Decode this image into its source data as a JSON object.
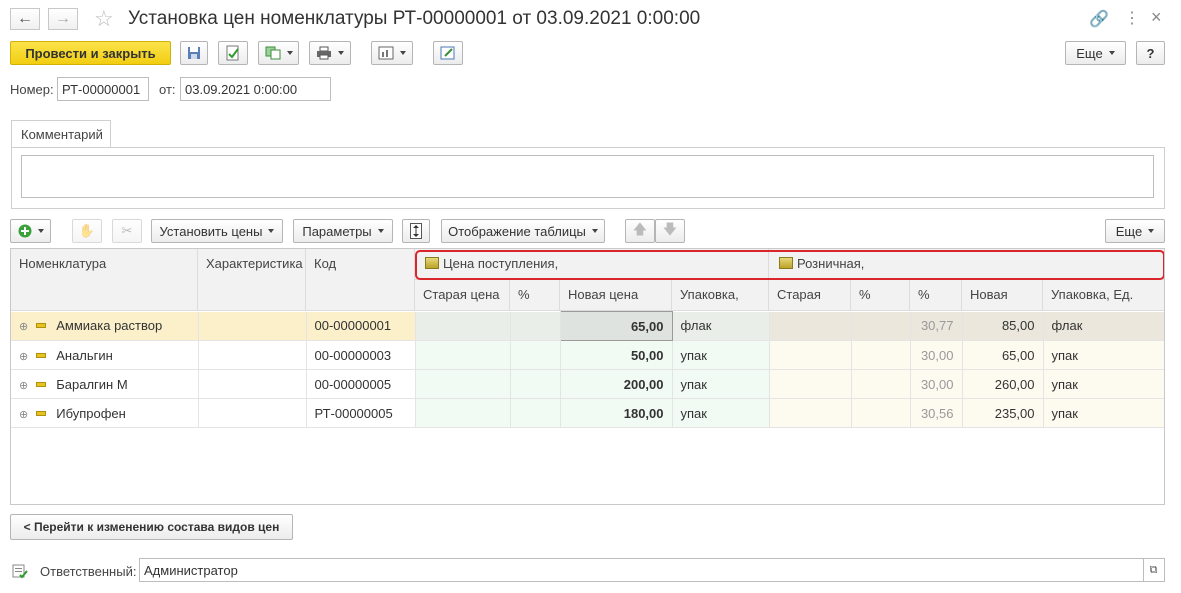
{
  "window": {
    "title": "Установка цен номенклатуры РТ-00000001 от 03.09.2021 0:00:00"
  },
  "toolbar": {
    "post_close_label": "Провести и закрыть",
    "more_label": "Еще",
    "help_label": "?"
  },
  "header": {
    "number_label": "Номер:",
    "number_value": "РТ-00000001",
    "date_label": "от:",
    "date_value": "03.09.2021  0:00:00"
  },
  "comment": {
    "tab_label": "Комментарий",
    "value": ""
  },
  "table_toolbar": {
    "set_prices_label": "Установить цены",
    "params_label": "Параметры",
    "display_label": "Отображение таблицы",
    "more_label": "Еще"
  },
  "table": {
    "columns": {
      "nomenclature": "Номенклатура",
      "characteristic": "Характеристика",
      "code": "Код",
      "group_purchase": "Цена поступления,",
      "group_retail": "Розничная,",
      "old_price": "Старая цена",
      "pct": "%",
      "new_price": "Новая цена",
      "pack": "Упаковка,",
      "retail_old": "Старая",
      "retail_pct1": "%",
      "retail_pct2": "%",
      "retail_new": "Новая",
      "retail_pack": "Упаковка, Ед."
    },
    "rows": [
      {
        "name": "Аммиака раствор",
        "code": "00-00000001",
        "new_price": "65,00",
        "pack": "флак",
        "retail_pct": "30,77",
        "retail_new": "85,00",
        "retail_pack": "флак"
      },
      {
        "name": "Анальгин",
        "code": "00-00000003",
        "new_price": "50,00",
        "pack": "упак",
        "retail_pct": "30,00",
        "retail_new": "65,00",
        "retail_pack": "упак"
      },
      {
        "name": "Баралгин М",
        "code": "00-00000005",
        "new_price": "200,00",
        "pack": "упак",
        "retail_pct": "30,00",
        "retail_new": "260,00",
        "retail_pack": "упак"
      },
      {
        "name": "Ибупрофен",
        "code": "РТ-00000005",
        "new_price": "180,00",
        "pack": "упак",
        "retail_pct": "30,56",
        "retail_new": "235,00",
        "retail_pack": "упак"
      }
    ]
  },
  "footer": {
    "goto_label": "< Перейти к изменению состава видов цен",
    "responsible_label": "Ответственный:",
    "responsible_value": "Администратор"
  },
  "colors": {
    "accent_yellow": "#f7d61e",
    "selected_row": "#fbf0c9",
    "highlight_red": "#d9262c",
    "purchase_bg": "#f1faf3",
    "retail_bg": "#fdfaf0"
  }
}
